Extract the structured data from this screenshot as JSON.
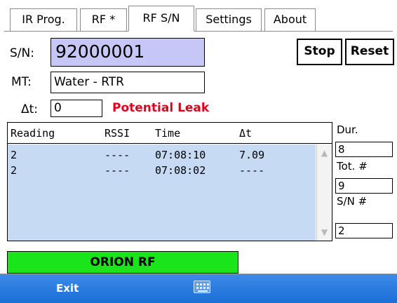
{
  "tabs": [
    {
      "label": "IR Prog.",
      "active": false
    },
    {
      "label": "RF *",
      "active": false
    },
    {
      "label": "RF S/N",
      "active": true
    },
    {
      "label": "Settings",
      "active": false
    },
    {
      "label": "About",
      "active": false
    }
  ],
  "form": {
    "sn_label": "S/N:",
    "sn_value": "92000001",
    "mt_label": "MT:",
    "mt_value": "Water - RTR",
    "dt_label": "Δt:",
    "dt_value": "0",
    "warning": "Potential Leak"
  },
  "buttons": {
    "stop": "Stop",
    "reset": "Reset"
  },
  "table": {
    "headers": [
      "Reading",
      "RSSI",
      "Time",
      "Δt"
    ],
    "rows": [
      [
        "2",
        "----",
        "07:08:10",
        "7.09"
      ],
      [
        "2",
        "----",
        "07:08:02",
        "----"
      ]
    ]
  },
  "side": {
    "dur_label": "Dur.",
    "dur_value": "8",
    "tot_label": "Tot. #",
    "tot_value": "9",
    "sn_count_label": "S/N #",
    "sn_count_value": "2"
  },
  "status": {
    "text": "ORION RF",
    "color": "#1ae41a"
  },
  "bottom": {
    "exit_label": "Exit",
    "keyboard_icon": "keyboard-icon"
  },
  "colors": {
    "sn_field_bg": "#c6c6f7",
    "warning": "#e0001b",
    "table_body": "#c7daf3",
    "bottom_bar": "#1b6fd6"
  }
}
